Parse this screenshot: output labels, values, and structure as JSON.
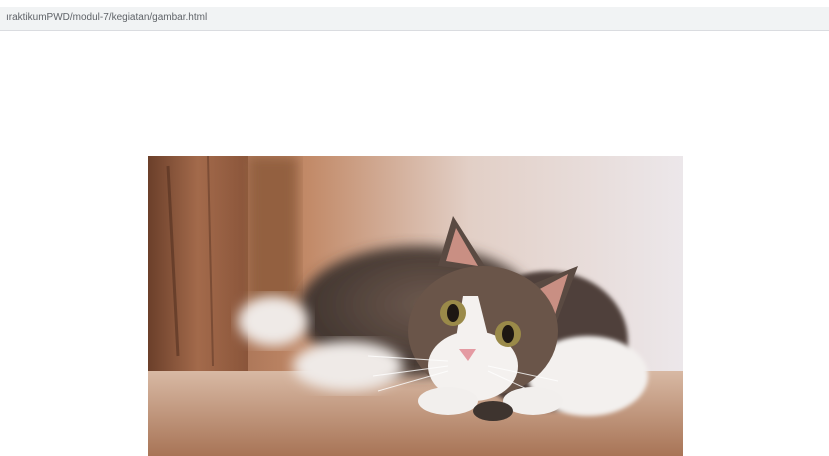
{
  "browser": {
    "url_text": "ıraktikumPWD/modul-7/kegiatan/gambar.html"
  },
  "content": {
    "image": {
      "subject": "cat-photo",
      "palette": {
        "wall": "#a0705a",
        "background": "#e6d7cf",
        "floor": "#c79d84",
        "fur_dark": "#5c4c44",
        "fur_white": "#f2efed",
        "nose": "#e49aa2"
      }
    }
  }
}
